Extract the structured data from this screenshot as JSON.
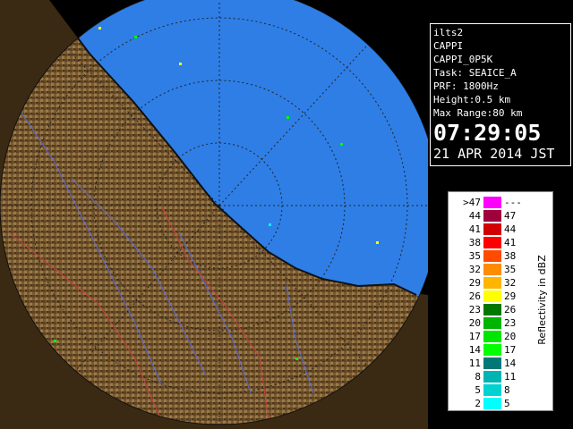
{
  "info": {
    "radar": "ilts2",
    "product": "CAPPI",
    "product_name": "CAPPI_0P5K",
    "task": "Task: SEAICE_A",
    "prf": "PRF: 1800Hz",
    "height": "Height:0.5 km",
    "max_range": "Max Range:80 km",
    "time": "07:29:05",
    "date": "21 APR 2014 JST"
  },
  "legend": {
    "unit": "Reflectivity in dBZ",
    "rows": [
      {
        "lo": ">47",
        "hi": "---",
        "color": "#ff00ff"
      },
      {
        "lo": "44",
        "hi": "47",
        "color": "#a0003c"
      },
      {
        "lo": "41",
        "hi": "44",
        "color": "#d20000"
      },
      {
        "lo": "38",
        "hi": "41",
        "color": "#ff0000"
      },
      {
        "lo": "35",
        "hi": "38",
        "color": "#ff4b00"
      },
      {
        "lo": "32",
        "hi": "35",
        "color": "#ff8c00"
      },
      {
        "lo": "29",
        "hi": "32",
        "color": "#ffb400"
      },
      {
        "lo": "26",
        "hi": "29",
        "color": "#ffff00"
      },
      {
        "lo": "23",
        "hi": "26",
        "color": "#007800"
      },
      {
        "lo": "20",
        "hi": "23",
        "color": "#00b400"
      },
      {
        "lo": "17",
        "hi": "20",
        "color": "#00e600"
      },
      {
        "lo": "14",
        "hi": "17",
        "color": "#00ff00"
      },
      {
        "lo": "11",
        "hi": "14",
        "color": "#007878"
      },
      {
        "lo": "8",
        "hi": "11",
        "color": "#00b4b4"
      },
      {
        "lo": "5",
        "hi": "8",
        "color": "#00d2d2"
      },
      {
        "lo": "2",
        "hi": "5",
        "color": "#00ffff"
      }
    ]
  },
  "colors": {
    "sea": "#2e7ee6",
    "ocean_far": "#0a2a9a",
    "land": "#7a5a30",
    "background": "#000000"
  }
}
